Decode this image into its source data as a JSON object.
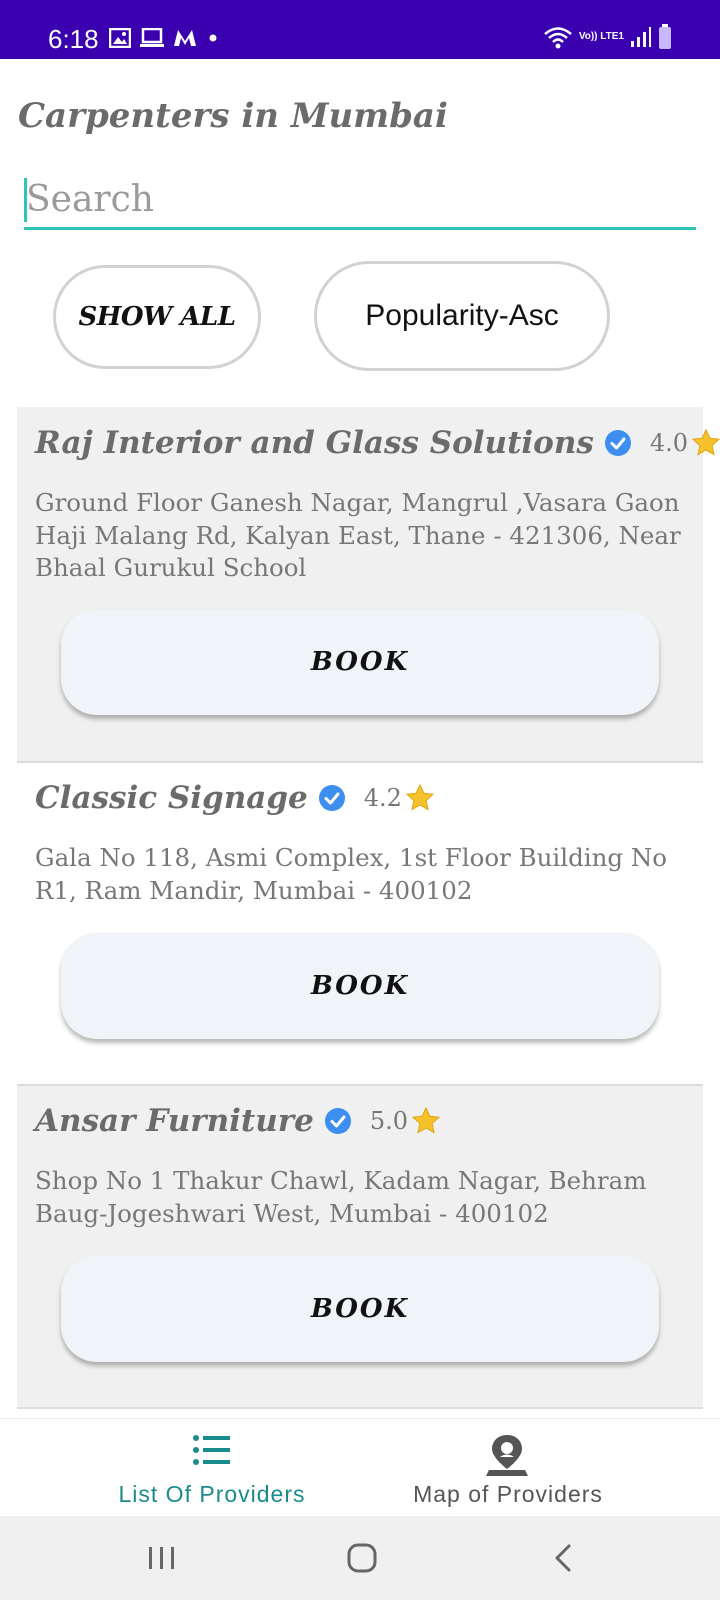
{
  "status_bar": {
    "time": "6:18",
    "network_label": "Vo)) LTE1",
    "left_icons": [
      "image-icon",
      "laptop-icon",
      "myntra-m-icon",
      "dot-icon"
    ],
    "right_icons": [
      "wifi-icon",
      "signal-icon",
      "battery-icon"
    ],
    "background": "#3a00b0"
  },
  "header": {
    "title": "Carpenters in Mumbai"
  },
  "search": {
    "placeholder": "Search",
    "value": "",
    "accent": "#2ec4b6"
  },
  "filters": {
    "show_all_label": "SHOW ALL",
    "sort_label": "Popularity-Asc"
  },
  "providers": [
    {
      "name": "Raj Interior and Glass Solutions",
      "rating": "4.0",
      "address": "Ground Floor  Ganesh Nagar, Mangrul ,Vasara Gaon Haji Malang Rd, Kalyan East, Thane - 421306, Near Bhaal Gurukul School",
      "book_label": "BOOK",
      "verified": true
    },
    {
      "name": "Classic Signage",
      "rating": "4.2",
      "address": "Gala No 118, Asmi Complex, 1st Floor Building No R1, Ram Mandir, Mumbai - 400102",
      "book_label": "BOOK",
      "verified": true
    },
    {
      "name": "Ansar Furniture",
      "rating": "5.0",
      "address": "Shop No 1 Thakur Chawl, Kadam Nagar, Behram Baug-Jogeshwari West, Mumbai - 400102",
      "book_label": "BOOK",
      "verified": true
    }
  ],
  "bottom_nav": {
    "items": [
      {
        "label": "List Of Providers",
        "icon": "list-icon",
        "active": true
      },
      {
        "label": "Map of Providers",
        "icon": "map-pin-icon",
        "active": false
      }
    ],
    "active_color": "#1a8a8a"
  },
  "system_nav": {
    "buttons": [
      "recent-apps-icon",
      "home-icon",
      "back-icon"
    ]
  }
}
